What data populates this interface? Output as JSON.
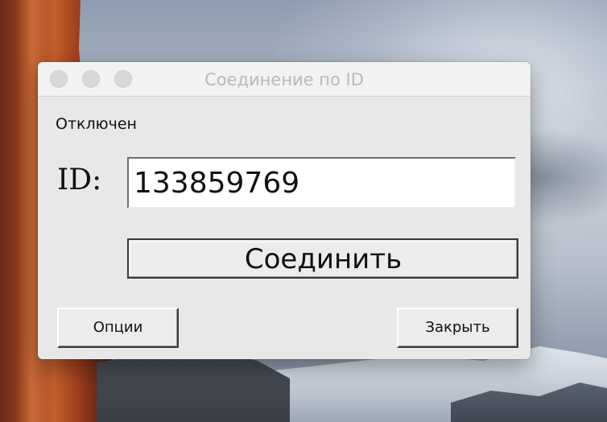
{
  "window": {
    "title": "Соединение по ID"
  },
  "status": {
    "text": "Отключен"
  },
  "id_field": {
    "label": "ID:",
    "value": "133859769"
  },
  "buttons": {
    "connect_label": "Соединить",
    "options_label": "Опции",
    "close_label": "Закрыть"
  },
  "icons": {
    "traffic_close": "close-dot-icon",
    "traffic_min": "minimize-dot-icon",
    "traffic_zoom": "zoom-dot-icon"
  },
  "colors": {
    "window_bg": "#e8e8e8",
    "title_inactive": "#b9b9b9",
    "traffic_inactive": "#d9d9d9"
  }
}
